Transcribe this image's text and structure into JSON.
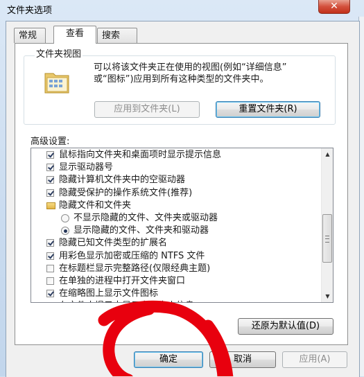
{
  "window": {
    "title": "文件夹选项",
    "close_symbol": "✕"
  },
  "tabs": [
    {
      "label": "常规",
      "active": false
    },
    {
      "label": "查看",
      "active": true
    },
    {
      "label": "搜索",
      "active": false
    }
  ],
  "folder_views": {
    "title": "文件夹视图",
    "description_line1": "可以将该文件夹正在使用的视图(例如“详细信息”",
    "description_line2": "或“图标”)应用到所有这种类型的文件夹中。",
    "apply_button": "应用到文件夹(L)",
    "reset_button": "重置文件夹(R)"
  },
  "advanced": {
    "label": "高级设置:",
    "items": [
      {
        "type": "checkbox",
        "checked": true,
        "indent": 0,
        "label": "鼠标指向文件夹和桌面项时显示提示信息"
      },
      {
        "type": "checkbox",
        "checked": true,
        "indent": 0,
        "label": "显示驱动器号"
      },
      {
        "type": "checkbox",
        "checked": true,
        "indent": 0,
        "label": "隐藏计算机文件夹中的空驱动器"
      },
      {
        "type": "checkbox",
        "checked": true,
        "indent": 0,
        "label": "隐藏受保护的操作系统文件(推荐)"
      },
      {
        "type": "folder",
        "checked": false,
        "indent": 0,
        "label": "隐藏文件和文件夹"
      },
      {
        "type": "radio",
        "checked": false,
        "indent": 1,
        "label": "不显示隐藏的文件、文件夹或驱动器"
      },
      {
        "type": "radio",
        "checked": true,
        "indent": 1,
        "label": "显示隐藏的文件、文件夹和驱动器"
      },
      {
        "type": "checkbox",
        "checked": true,
        "indent": 0,
        "label": "隐藏已知文件类型的扩展名"
      },
      {
        "type": "checkbox",
        "checked": true,
        "indent": 0,
        "label": "用彩色显示加密或压缩的 NTFS 文件"
      },
      {
        "type": "checkbox",
        "checked": false,
        "indent": 0,
        "label": "在标题栏显示完整路径(仅限经典主题)"
      },
      {
        "type": "checkbox",
        "checked": false,
        "indent": 0,
        "label": "在单独的进程中打开文件夹窗口"
      },
      {
        "type": "checkbox",
        "checked": true,
        "indent": 0,
        "label": "在缩略图上显示文件图标"
      },
      {
        "type": "checkbox",
        "checked": false,
        "indent": 0,
        "label": "在文件夹提示中显示文件大小信息"
      }
    ],
    "restore_defaults_button": "还原为默认值(D)"
  },
  "footer": {
    "ok_button": "确定",
    "cancel_button": "取消",
    "apply_button": "应用(A)"
  },
  "colors": {
    "annotation_scribble": "#e8000e",
    "checkbox_mark": "#2d3e61",
    "default_button_border": "#3c7fb1"
  }
}
